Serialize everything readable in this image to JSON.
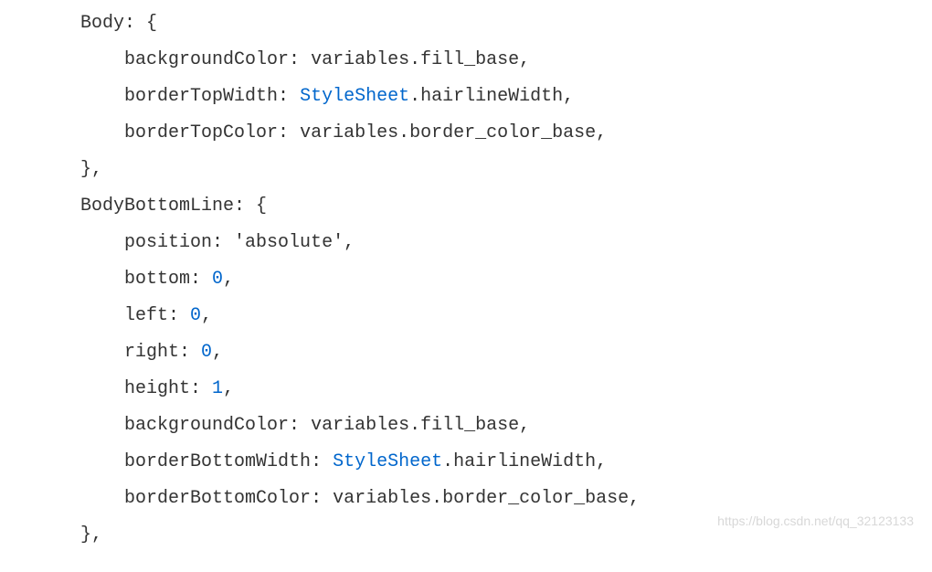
{
  "code": {
    "lines": [
      {
        "indent": 2,
        "tokens": [
          {
            "t": "},",
            "c": "punctuation"
          }
        ]
      },
      {
        "indent": 2,
        "tokens": [
          {
            "t": "Body",
            "c": "property"
          },
          {
            "t": ": {",
            "c": "punctuation"
          }
        ]
      },
      {
        "indent": 4,
        "tokens": [
          {
            "t": "backgroundColor",
            "c": "property"
          },
          {
            "t": ": ",
            "c": "punctuation"
          },
          {
            "t": "variables",
            "c": "identifier"
          },
          {
            "t": ".",
            "c": "punctuation"
          },
          {
            "t": "fill_base",
            "c": "identifier"
          },
          {
            "t": ",",
            "c": "punctuation"
          }
        ]
      },
      {
        "indent": 4,
        "tokens": [
          {
            "t": "borderTopWidth",
            "c": "property"
          },
          {
            "t": ": ",
            "c": "punctuation"
          },
          {
            "t": "StyleSheet",
            "c": "keyword"
          },
          {
            "t": ".",
            "c": "punctuation"
          },
          {
            "t": "hairlineWidth",
            "c": "identifier"
          },
          {
            "t": ",",
            "c": "punctuation"
          }
        ]
      },
      {
        "indent": 4,
        "tokens": [
          {
            "t": "borderTopColor",
            "c": "property"
          },
          {
            "t": ": ",
            "c": "punctuation"
          },
          {
            "t": "variables",
            "c": "identifier"
          },
          {
            "t": ".",
            "c": "punctuation"
          },
          {
            "t": "border_color_base",
            "c": "identifier"
          },
          {
            "t": ",",
            "c": "punctuation"
          }
        ]
      },
      {
        "indent": 2,
        "tokens": [
          {
            "t": "},",
            "c": "punctuation"
          }
        ]
      },
      {
        "indent": 2,
        "tokens": [
          {
            "t": "BodyBottomLine",
            "c": "property"
          },
          {
            "t": ": {",
            "c": "punctuation"
          }
        ]
      },
      {
        "indent": 4,
        "tokens": [
          {
            "t": "position",
            "c": "property"
          },
          {
            "t": ": ",
            "c": "punctuation"
          },
          {
            "t": "'absolute'",
            "c": "string"
          },
          {
            "t": ",",
            "c": "punctuation"
          }
        ]
      },
      {
        "indent": 4,
        "tokens": [
          {
            "t": "bottom",
            "c": "property"
          },
          {
            "t": ": ",
            "c": "punctuation"
          },
          {
            "t": "0",
            "c": "number"
          },
          {
            "t": ",",
            "c": "punctuation"
          }
        ]
      },
      {
        "indent": 4,
        "tokens": [
          {
            "t": "left",
            "c": "property"
          },
          {
            "t": ": ",
            "c": "punctuation"
          },
          {
            "t": "0",
            "c": "number"
          },
          {
            "t": ",",
            "c": "punctuation"
          }
        ]
      },
      {
        "indent": 4,
        "tokens": [
          {
            "t": "right",
            "c": "property"
          },
          {
            "t": ": ",
            "c": "punctuation"
          },
          {
            "t": "0",
            "c": "number"
          },
          {
            "t": ",",
            "c": "punctuation"
          }
        ]
      },
      {
        "indent": 4,
        "tokens": [
          {
            "t": "height",
            "c": "property"
          },
          {
            "t": ": ",
            "c": "punctuation"
          },
          {
            "t": "1",
            "c": "number"
          },
          {
            "t": ",",
            "c": "punctuation"
          }
        ]
      },
      {
        "indent": 4,
        "tokens": [
          {
            "t": "backgroundColor",
            "c": "property"
          },
          {
            "t": ": ",
            "c": "punctuation"
          },
          {
            "t": "variables",
            "c": "identifier"
          },
          {
            "t": ".",
            "c": "punctuation"
          },
          {
            "t": "fill_base",
            "c": "identifier"
          },
          {
            "t": ",",
            "c": "punctuation"
          }
        ]
      },
      {
        "indent": 4,
        "tokens": [
          {
            "t": "borderBottomWidth",
            "c": "property"
          },
          {
            "t": ": ",
            "c": "punctuation"
          },
          {
            "t": "StyleSheet",
            "c": "keyword"
          },
          {
            "t": ".",
            "c": "punctuation"
          },
          {
            "t": "hairlineWidth",
            "c": "identifier"
          },
          {
            "t": ",",
            "c": "punctuation"
          }
        ]
      },
      {
        "indent": 4,
        "tokens": [
          {
            "t": "borderBottomColor",
            "c": "property"
          },
          {
            "t": ": ",
            "c": "punctuation"
          },
          {
            "t": "variables",
            "c": "identifier"
          },
          {
            "t": ".",
            "c": "punctuation"
          },
          {
            "t": "border_color_base",
            "c": "identifier"
          },
          {
            "t": ",",
            "c": "punctuation"
          }
        ]
      },
      {
        "indent": 2,
        "tokens": [
          {
            "t": "},",
            "c": "punctuation"
          }
        ]
      }
    ]
  },
  "watermark": "https://blog.csdn.net/qq_32123133"
}
